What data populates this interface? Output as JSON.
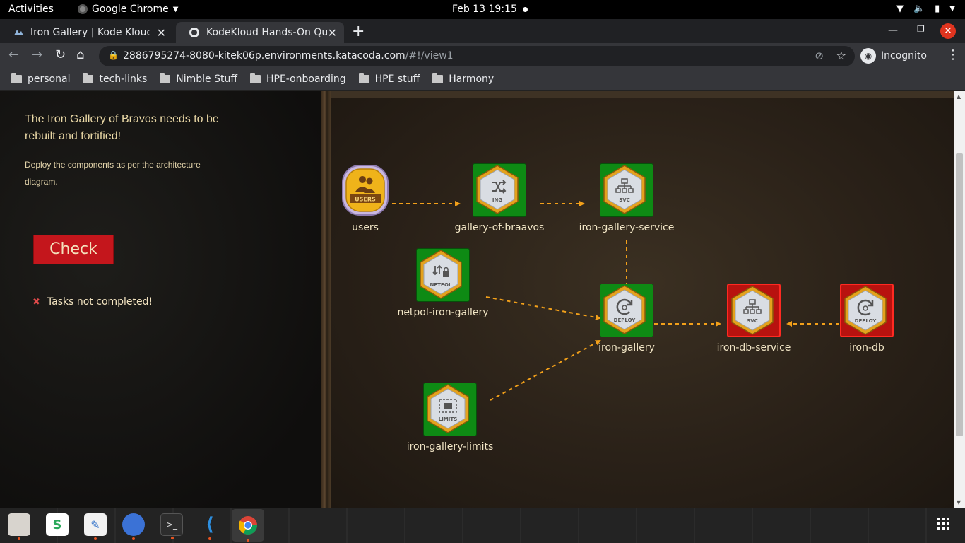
{
  "topbar": {
    "activities": "Activities",
    "app_name": "Google Chrome",
    "clock": "Feb 13  19:15"
  },
  "tabs": [
    {
      "title": "Iron Gallery | Kode Kloud",
      "active": false
    },
    {
      "title": "KodeKloud Hands-On Quiz",
      "active": true
    }
  ],
  "toolbar": {
    "url_host": "2886795274-8080-kitek06p.environments.katacoda.com",
    "url_path": "/#!/view1",
    "profile_label": "Incognito"
  },
  "bookmarks": [
    "personal",
    "tech-links",
    "Nimble Stuff",
    "HPE-onboarding",
    "HPE stuff",
    "Harmony"
  ],
  "left_panel": {
    "headline": "The Iron Gallery of Bravos needs to be rebuilt and fortified!",
    "instruction": "Deploy the components as per the architecture diagram.",
    "check_button": "Check",
    "status": "Tasks not completed!"
  },
  "diagram": {
    "nodes": [
      {
        "id": "users",
        "label": "users",
        "badge": "USERS",
        "kind": "users",
        "status": "neutral"
      },
      {
        "id": "gallery-of-braavos",
        "label": "gallery-of-braavos",
        "badge": "ING",
        "kind": "ingress",
        "status": "done"
      },
      {
        "id": "iron-gallery-service",
        "label": "iron-gallery-service",
        "badge": "SVC",
        "kind": "service",
        "status": "done"
      },
      {
        "id": "netpol-iron-gallery",
        "label": "netpol-iron-gallery",
        "badge": "NETPOL",
        "kind": "netpol",
        "status": "done"
      },
      {
        "id": "iron-gallery",
        "label": "iron-gallery",
        "badge": "DEPLOY",
        "kind": "deploy",
        "status": "done"
      },
      {
        "id": "iron-db-service",
        "label": "iron-db-service",
        "badge": "SVC",
        "kind": "service",
        "status": "failed"
      },
      {
        "id": "iron-db",
        "label": "iron-db",
        "badge": "DEPLOY",
        "kind": "deploy",
        "status": "failed"
      },
      {
        "id": "iron-gallery-limits",
        "label": "iron-gallery-limits",
        "badge": "LIMITS",
        "kind": "limits",
        "status": "done"
      }
    ],
    "edges": [
      {
        "from": "users",
        "to": "gallery-of-braavos"
      },
      {
        "from": "gallery-of-braavos",
        "to": "iron-gallery-service"
      },
      {
        "from": "iron-gallery-service",
        "to": "iron-gallery"
      },
      {
        "from": "netpol-iron-gallery",
        "to": "iron-gallery"
      },
      {
        "from": "iron-gallery-limits",
        "to": "iron-gallery"
      },
      {
        "from": "iron-gallery",
        "to": "iron-db-service"
      },
      {
        "from": "iron-db",
        "to": "iron-db-service"
      }
    ]
  },
  "colors": {
    "done": "#0e8a14",
    "failed": "#b8120f",
    "edge": "#f2a01a",
    "hex_gold": "#e4a21d",
    "check_button": "#c4161c"
  }
}
